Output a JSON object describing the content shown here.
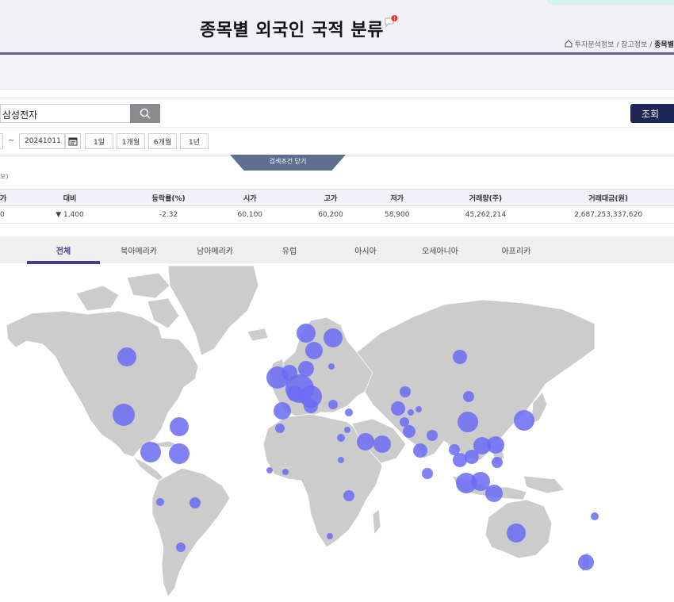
{
  "header": {
    "title": "종목별 외국인 국적 분류",
    "breadcrumb": {
      "item1": "투자분석정보",
      "item2": "참고정보",
      "current": "종목별"
    }
  },
  "search": {
    "value": "삼성전자",
    "query_button": "조회"
  },
  "date_filter": {
    "tilde": "~",
    "end_date": "20241011",
    "periods": [
      "1일",
      "1개월",
      "6개월",
      "1년"
    ]
  },
  "toggle_label": "검색조건 닫기",
  "note_partial": "보)",
  "quote_table": {
    "headers": [
      "가",
      "대비",
      "등락률(%)",
      "시가",
      "고가",
      "저가",
      "거래량(주)",
      "거래대금(원)"
    ],
    "row": [
      "0",
      "▼ 1,400",
      "-2.32",
      "60,100",
      "60,200",
      "58,900",
      "45,262,214",
      "2,687,253,337,620"
    ]
  },
  "region_tabs": [
    {
      "label": "전체",
      "active": true
    },
    {
      "label": "북아메리카",
      "active": false
    },
    {
      "label": "남아메리카",
      "active": false
    },
    {
      "label": "유럽",
      "active": false
    },
    {
      "label": "아시아",
      "active": false
    },
    {
      "label": "오세아니아",
      "active": false
    },
    {
      "label": "아프리카",
      "active": false
    }
  ],
  "map": {
    "land_color": "#cccccc",
    "bubble_color": "#6b6bf5"
  },
  "colors": {
    "accent": "#4b3a8a",
    "query_button_bg": "#1e2656",
    "down_blue": "#1a8fd4"
  }
}
